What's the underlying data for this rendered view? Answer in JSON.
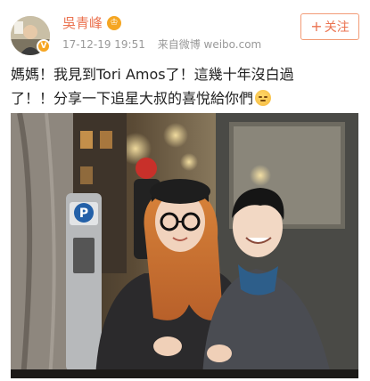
{
  "post": {
    "author": "吳青峰",
    "vip_icon": "crown-icon",
    "verified_icon": "verified-v-icon",
    "timestamp": "17-12-19 19:51",
    "source": "来自微博 weibo.com",
    "follow_label": "关注",
    "follow_plus": "+",
    "text_line1": "媽媽！我見到Tori Amos了！這幾十年沒白過",
    "text_line2": "了！！分享一下追星大叔的喜悅給你們",
    "emoji": "smile-emoji-icon"
  },
  "colors": {
    "accent": "#eb7350",
    "meta_gray": "#999999",
    "text": "#222222"
  }
}
